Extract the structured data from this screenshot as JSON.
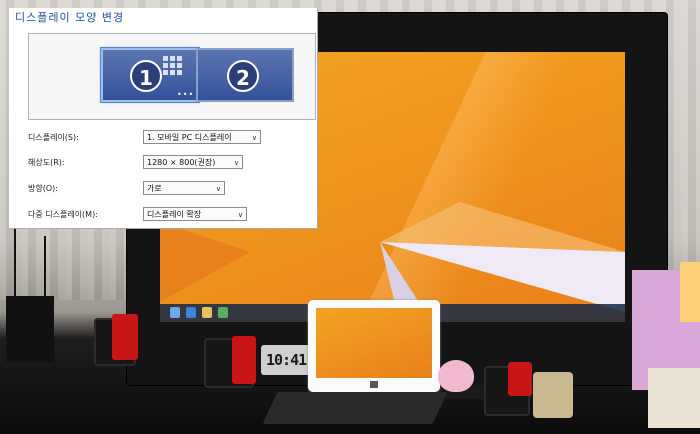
{
  "dialog": {
    "title": "디스플레이 모양 변경",
    "monitors": [
      {
        "number": "1",
        "selected": true
      },
      {
        "number": "2",
        "selected": false
      }
    ],
    "fields": [
      {
        "label": "디스플레이(S):",
        "value": "1. 모바일 PC 디스플레이"
      },
      {
        "label": "해상도(R):",
        "value": "1280 × 800(권장)"
      },
      {
        "label": "방향(O):",
        "value": "가로"
      },
      {
        "label": "다중 디스플레이(M):",
        "value": "디스플레이 확장"
      }
    ]
  },
  "photo": {
    "clock_text": "10:41",
    "colors": {
      "wallpaper": "#f0951c",
      "speaker_red": "#c81616",
      "dialog_accent": "#1e4f9c"
    }
  }
}
